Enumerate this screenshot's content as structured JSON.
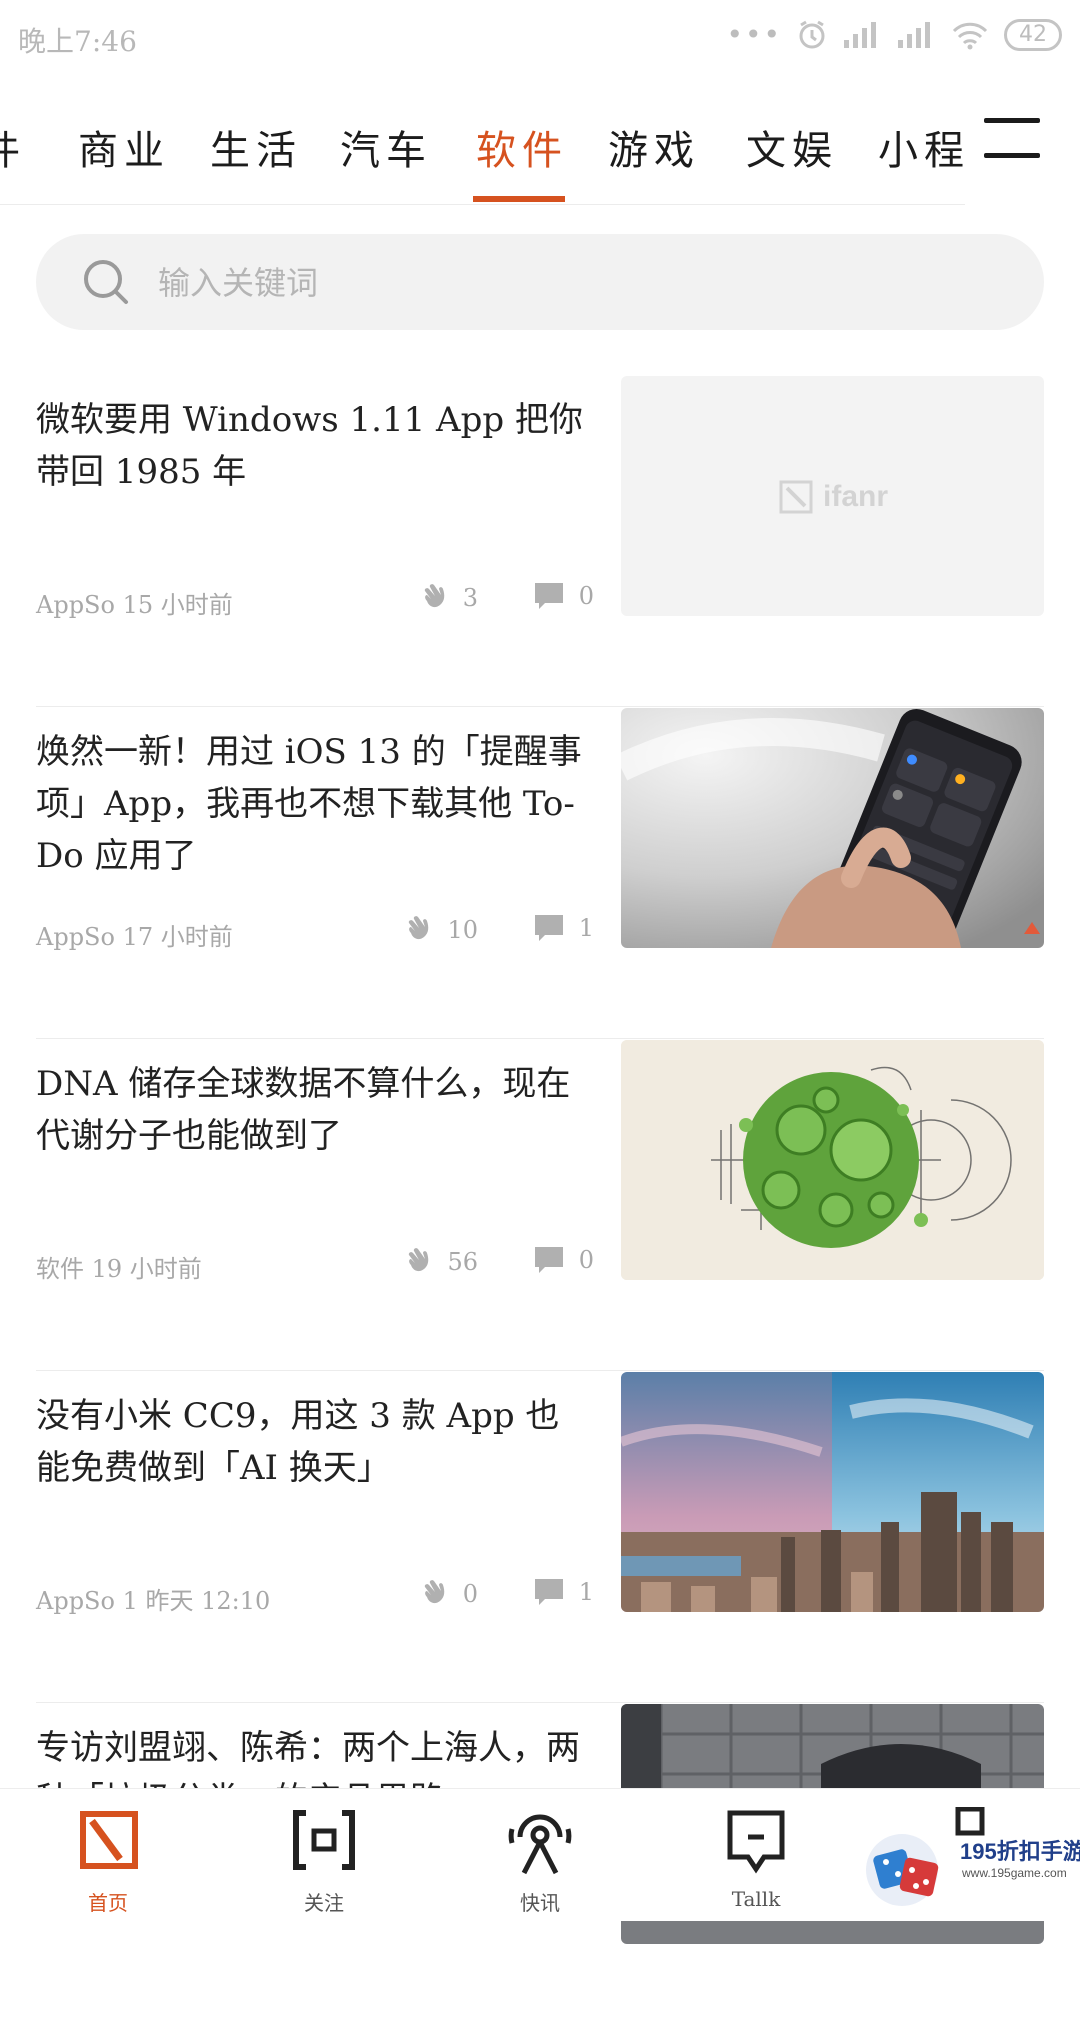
{
  "status_bar": {
    "time": "晚上7:46",
    "battery": "42"
  },
  "tabs": [
    {
      "label": "件"
    },
    {
      "label": "商业"
    },
    {
      "label": "生活"
    },
    {
      "label": "汽车"
    },
    {
      "label": "软件",
      "active": true
    },
    {
      "label": "游戏"
    },
    {
      "label": "文娱"
    },
    {
      "label": "小程"
    }
  ],
  "search": {
    "placeholder": "输入关键词"
  },
  "articles": [
    {
      "title": "微软要用 Windows 1.11 App 把你带回 1985 年",
      "source": "AppSo 15 小时前",
      "likes": "3",
      "comments": "0",
      "thumb_brand": "ifanr"
    },
    {
      "title": "焕然一新！用过 iOS 13 的「提醒事项」App，我再也不想下载其他 To-Do 应用了",
      "source": "AppSo 17 小时前",
      "likes": "10",
      "comments": "1"
    },
    {
      "title": "DNA 储存全球数据不算什么，现在代谢分子也能做到了",
      "source": "软件 19 小时前",
      "likes": "56",
      "comments": "0"
    },
    {
      "title": "没有小米 CC9，用这 3 款 App 也能免费做到「AI 换天」",
      "source": "AppSo 1 昨天 12:10",
      "likes": "0",
      "comments": "1"
    },
    {
      "title": "专访刘盟翊、陈希：两个上海人，两种「垃圾分类」的产品思路"
    }
  ],
  "bottom_nav": [
    {
      "label": "首页",
      "active": true
    },
    {
      "label": "关注"
    },
    {
      "label": "快讯"
    },
    {
      "label": "Tallk"
    }
  ],
  "watermark": {
    "text": "195折扣手游",
    "url": "www.195game.com"
  },
  "colors": {
    "accent": "#d6521f",
    "muted": "#a8a8a8"
  }
}
